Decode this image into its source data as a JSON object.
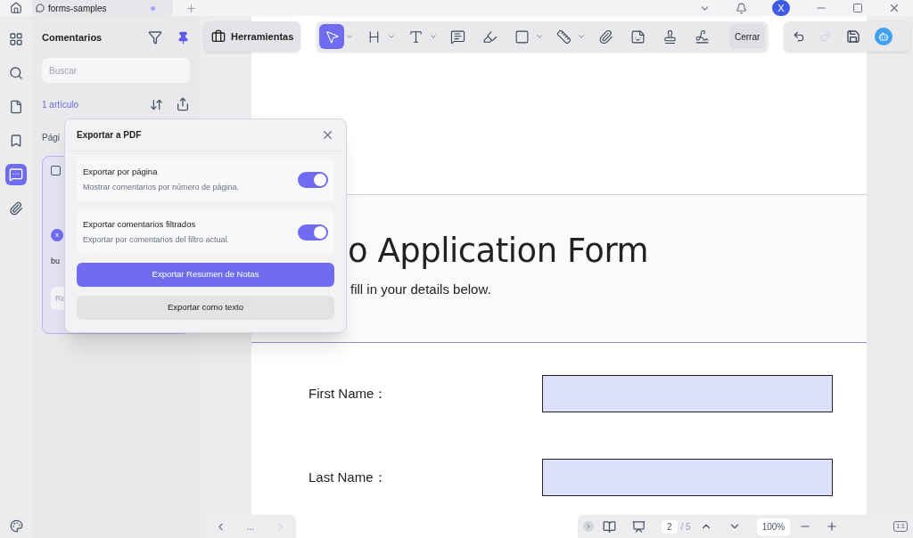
{
  "tab_bar": {
    "tab": {
      "title": "forms-samples",
      "unsaved": true
    },
    "avatar": "X"
  },
  "sidebar": {
    "items": [
      {
        "kind": "thumbnails",
        "selected": false
      },
      {
        "kind": "search",
        "selected": false
      },
      {
        "kind": "pages",
        "selected": false
      },
      {
        "kind": "bookmarks",
        "selected": false
      },
      {
        "kind": "comments",
        "selected": true
      },
      {
        "kind": "attachments",
        "selected": false
      }
    ]
  },
  "comments_panel": {
    "title": "Comentarios",
    "pinned": true,
    "search_placeholder": "Buscar",
    "count": "1 artículo",
    "group_label": "Pági",
    "card": {
      "checked": false,
      "avatar": "x",
      "text": "bu",
      "reply_placeholder": "Re"
    }
  },
  "toolbar": {
    "tools_button": "Herramientas",
    "tools": [
      {
        "kind": "select",
        "selected": true,
        "menu": true
      },
      {
        "kind": "heading",
        "selected": false,
        "menu": true
      },
      {
        "kind": "text",
        "selected": false,
        "menu": true
      },
      {
        "kind": "comment",
        "selected": false,
        "menu": false
      },
      {
        "kind": "highlight",
        "selected": false,
        "menu": false
      },
      {
        "kind": "shape",
        "selected": false,
        "menu": true
      },
      {
        "kind": "measure",
        "selected": false,
        "menu": true
      },
      {
        "kind": "attach",
        "selected": false,
        "menu": false
      },
      {
        "kind": "sticker",
        "selected": false,
        "menu": false
      },
      {
        "kind": "stamp",
        "selected": false,
        "menu": false
      },
      {
        "kind": "signature",
        "selected": false,
        "menu": false
      }
    ],
    "close_button": "Cerrar"
  },
  "document": {
    "title": "o Application Form",
    "subtitle": "fill in your details below.",
    "fields": [
      {
        "label": "First Name："
      },
      {
        "label": "Last Name："
      }
    ]
  },
  "dialog": {
    "title": "Exportar a PDF",
    "options": [
      {
        "title": "Exportar por página",
        "description": "Mostrar comentarios por número de página.",
        "on": true
      },
      {
        "title": "Exportar comentarios filtrados",
        "description": "Exportar por comentarios del filtro actual.",
        "on": true
      }
    ],
    "primary_button": "Exportar Resumen de Notas",
    "secondary_button": "Exportar como texto"
  },
  "pager": {
    "ellipsis": "..."
  },
  "status_bar": {
    "page": "2",
    "total": "/ 5",
    "zoom": "100%",
    "actual_size": "1:1"
  }
}
